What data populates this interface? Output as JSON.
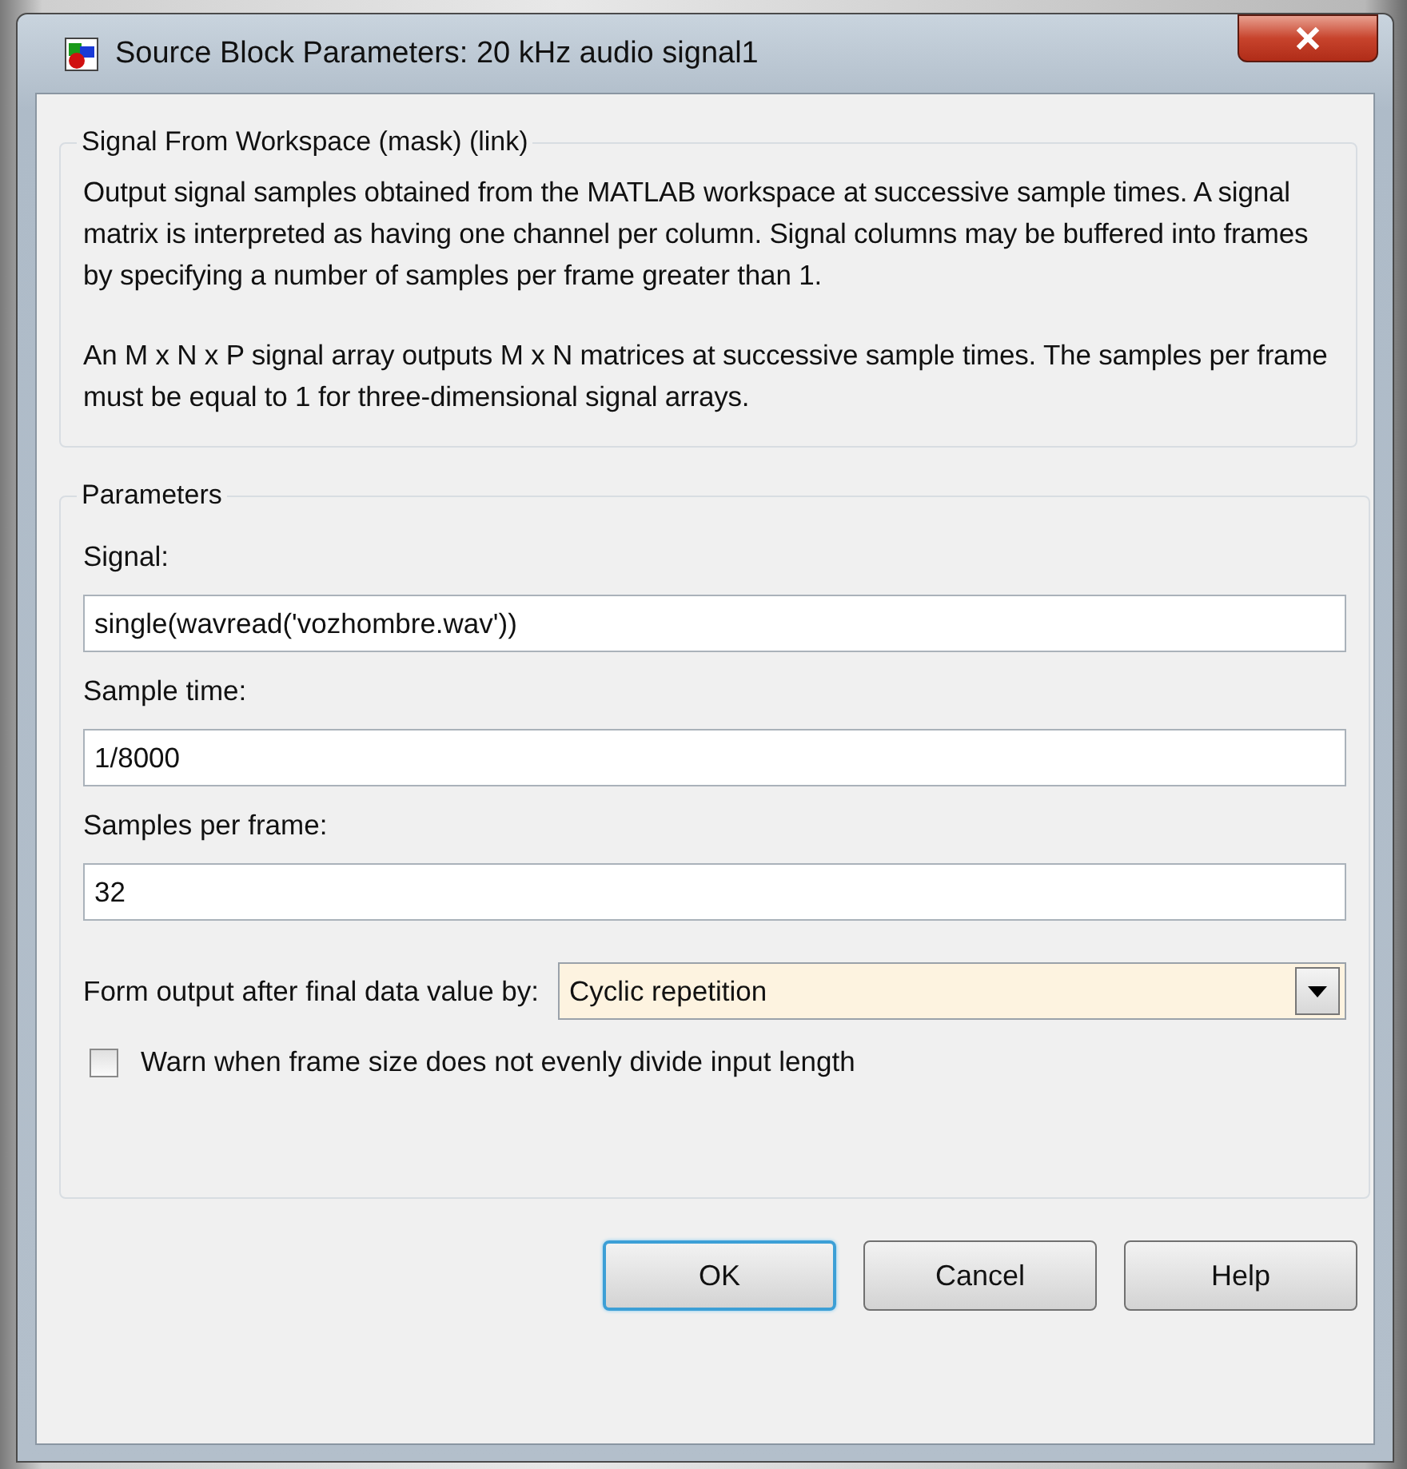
{
  "window": {
    "title": "Source Block Parameters: 20 kHz audio signal1"
  },
  "description": {
    "title": "Signal From Workspace (mask) (link)",
    "paragraphs": [
      "Output signal samples obtained from the MATLAB workspace at successive sample times.  A signal matrix is interpreted as having one channel per column.  Signal columns may be buffered into frames by specifying a number of samples per frame greater than 1.",
      "An M x N x P signal array outputs M x N matrices at successive sample times.  The samples per frame must be equal to 1 for three-dimensional signal arrays."
    ]
  },
  "parameters": {
    "title": "Parameters",
    "fields": [
      {
        "label": "Signal:",
        "value": "single(wavread('vozhombre.wav'))"
      },
      {
        "label": "Sample time:",
        "value": "1/8000"
      },
      {
        "label": "Samples per frame:",
        "value": "32"
      }
    ],
    "dropdown": {
      "label": "Form output after final data value by:",
      "value": "Cyclic repetition"
    },
    "checkbox": {
      "label": "Warn when frame size does not evenly divide input length",
      "checked": false
    }
  },
  "buttons": [
    {
      "label": "OK",
      "default": true
    },
    {
      "label": "Cancel",
      "default": false
    },
    {
      "label": "Help",
      "default": false
    }
  ]
}
